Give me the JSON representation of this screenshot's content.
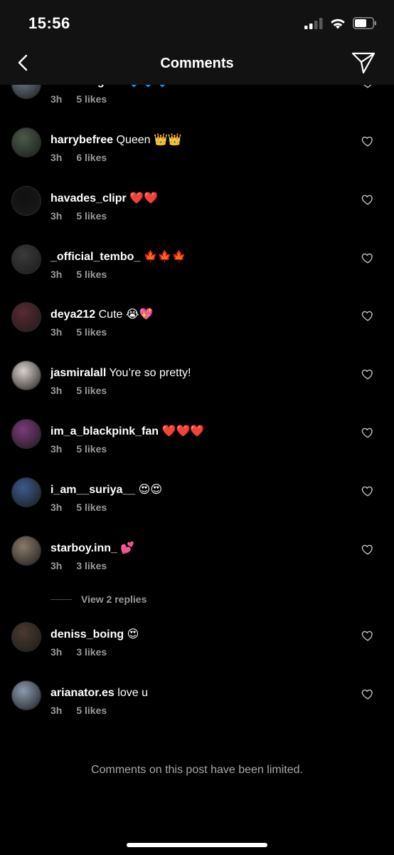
{
  "status_bar": {
    "time": "15:56"
  },
  "header": {
    "title": "Comments"
  },
  "comments": [
    {
      "username": "carlosengeds",
      "text": "",
      "emoji": "🔷🔷🔷",
      "time": "3h",
      "likes": "5 likes",
      "avatar_color": "#6a7a8a"
    },
    {
      "username": "harrybefree",
      "text": "Queen",
      "emoji": "👑👑",
      "time": "3h",
      "likes": "6 likes",
      "avatar_color": "#4a5a48"
    },
    {
      "username": "havades_clipr",
      "text": "",
      "emoji": "❤️❤️",
      "time": "3h",
      "likes": "5 likes",
      "avatar_color": "#111111"
    },
    {
      "username": "_official_tembo_",
      "text": "",
      "emoji": "🍁🍁🍁",
      "time": "3h",
      "likes": "5 likes",
      "avatar_color": "#3a3a3a"
    },
    {
      "username": "deya212",
      "text": "Cute",
      "emoji": "😭💖",
      "time": "3h",
      "likes": "5 likes",
      "avatar_color": "#5a2a30"
    },
    {
      "username": "jasmiralall",
      "text": "You’re so pretty!",
      "emoji": "",
      "time": "3h",
      "likes": "5 likes",
      "avatar_color": "#d8d0cc"
    },
    {
      "username": "im_a_blackpink_fan",
      "text": "",
      "emoji": "❤️❤️❤️",
      "time": "3h",
      "likes": "5 likes",
      "avatar_color": "#7a3a7a"
    },
    {
      "username": "i_am__suriya__",
      "text": "",
      "emoji": "😍😍",
      "time": "3h",
      "likes": "5 likes",
      "avatar_color": "#3a5a8a"
    },
    {
      "username": "starboy.inn_",
      "text": "",
      "emoji": "💕",
      "time": "3h",
      "likes": "3 likes",
      "avatar_color": "#8a7a6a"
    },
    {
      "username": "deniss_boing",
      "text": "",
      "emoji": "😍",
      "time": "3h",
      "likes": "3 likes",
      "avatar_color": "#4a3a30"
    },
    {
      "username": "arianator.es",
      "text": "love u",
      "emoji": "",
      "time": "3h",
      "likes": "5 likes",
      "avatar_color": "#8a9ab0"
    }
  ],
  "view_replies": "View 2 replies",
  "footer_notice": "Comments on this post have been limited."
}
